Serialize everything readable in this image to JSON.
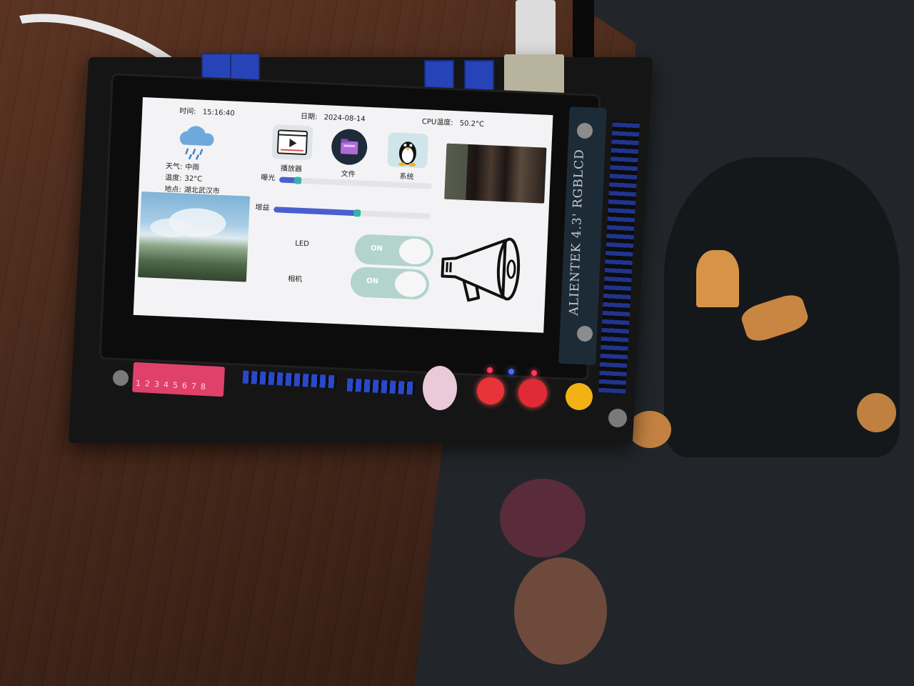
{
  "screen": {
    "time_label": "时间:",
    "time_value": "15:16:40",
    "date_label": "日期:",
    "date_value": "2024-08-14",
    "cpu_label": "CPU温度:",
    "cpu_value": "50.2°C",
    "weather": {
      "condition_label": "天气:",
      "condition_value": "中雨",
      "temp_label": "温度:",
      "temp_value": "32°C",
      "location_label": "地点:",
      "location_value": "湖北武汉市",
      "icon": "rain-cloud-icon"
    },
    "apps": [
      {
        "label": "播放器",
        "icon": "video-player-icon"
      },
      {
        "label": "文件",
        "icon": "folder-icon"
      },
      {
        "label": "系统",
        "icon": "linux-penguin-icon"
      }
    ],
    "sliders": [
      {
        "label": "曝光",
        "value_fraction": 0.12
      },
      {
        "label": "增益",
        "value_fraction": 0.53
      }
    ],
    "switches": [
      {
        "label": "LED",
        "state": "ON"
      },
      {
        "label": "相机",
        "state": "ON"
      }
    ],
    "megaphone_icon": "megaphone-icon",
    "accent_color": "#4a5fcf",
    "switch_color": "#b3d3cd"
  },
  "board": {
    "lcd_brand": "ALIENTEK 4.3' RGBLCD",
    "dip_numbers": "12345678"
  }
}
